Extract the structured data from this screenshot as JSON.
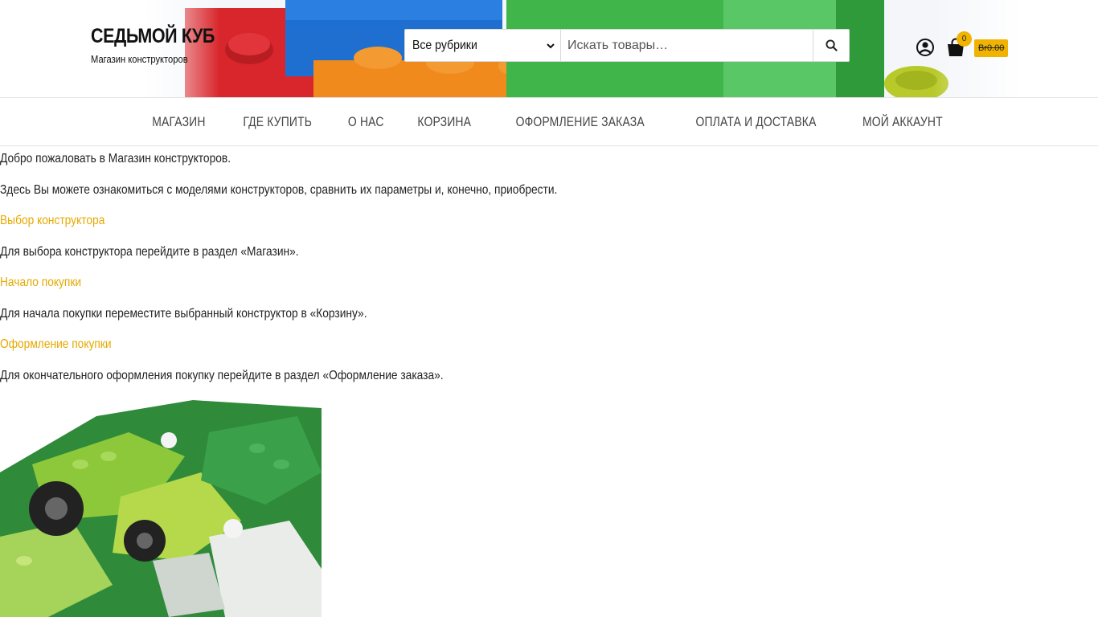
{
  "header": {
    "site_title": "СЕДЬМОЙ КУБ",
    "site_description": "Магазин конструкторов",
    "search": {
      "category_selected": "Все рубрики",
      "placeholder": "Искать товары…"
    },
    "cart": {
      "count": "0",
      "total": "Br0.00"
    },
    "icons": [
      "account-icon",
      "shopping-bag-icon",
      "search-icon",
      "chevron-down-icon"
    ]
  },
  "nav": {
    "items": [
      {
        "label": "Магазин"
      },
      {
        "label": "Где купить"
      },
      {
        "label": "О нас"
      },
      {
        "label": "Корзина"
      },
      {
        "label": "Оформление заказа"
      },
      {
        "label": "Оплата и доставка"
      },
      {
        "label": "Мой аккаунт"
      }
    ]
  },
  "content": {
    "welcome": "Добро пожаловать в Магазин конструкторов.",
    "intro": "Здесь Вы можете ознакомиться с моделями конструкторов, сравнить их параметры и, конечно, приобрести.",
    "sections": [
      {
        "heading": "Выбор конструктора",
        "text": "Для выбора конструктора перейдите в раздел «Магазин»."
      },
      {
        "heading": "Начало покупки",
        "text": "Для начала покупки переместите выбранный конструктор в «Корзину»."
      },
      {
        "heading": "Оформление покупки",
        "text": "Для окончательного оформления покупку перейдите в раздел «Оформление заказа»."
      }
    ]
  },
  "colors": {
    "accent": "#f0b400",
    "link": "#e6a800",
    "text": "#222222",
    "border": "#e3e3e3"
  }
}
